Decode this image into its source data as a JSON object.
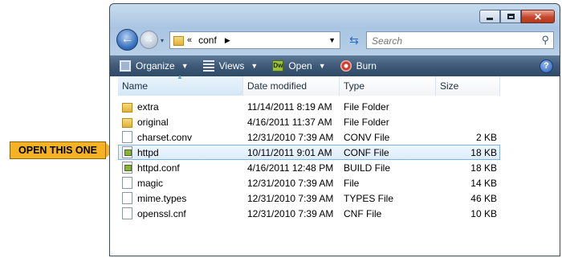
{
  "callout": {
    "text": "OPEN THIS ONE"
  },
  "nav": {
    "history_glyph": "▾",
    "breadcrumb_overflow": "«",
    "breadcrumb": "conf",
    "crumb_arrow": "▶",
    "address_dropdown": "▼",
    "refresh_icon": "refresh-icon"
  },
  "search": {
    "placeholder": "Search"
  },
  "toolbar": {
    "organize": "Organize",
    "views": "Views",
    "open": "Open",
    "burn": "Burn",
    "dropdown_glyph": "▼",
    "open_app_badge": "Dw"
  },
  "columns": {
    "name": "Name",
    "date": "Date modified",
    "type": "Type",
    "size": "Size"
  },
  "files": [
    {
      "name": "extra",
      "date": "11/14/2011 8:19 AM",
      "type": "File Folder",
      "size": "",
      "icon": "folder-icon"
    },
    {
      "name": "original",
      "date": "4/16/2011 11:37 AM",
      "type": "File Folder",
      "size": "",
      "icon": "folder-icon"
    },
    {
      "name": "charset.conv",
      "date": "12/31/2010 7:39 AM",
      "type": "CONV File",
      "size": "2 KB",
      "icon": "file-icon"
    },
    {
      "name": "httpd",
      "date": "10/11/2011 9:01 AM",
      "type": "CONF File",
      "size": "18 KB",
      "icon": "dreamweaver-file-icon",
      "selected": true
    },
    {
      "name": "httpd.conf",
      "date": "4/16/2011 12:48 PM",
      "type": "BUILD File",
      "size": "18 KB",
      "icon": "dreamweaver-file-icon"
    },
    {
      "name": "magic",
      "date": "12/31/2010 7:39 AM",
      "type": "File",
      "size": "14 KB",
      "icon": "file-icon"
    },
    {
      "name": "mime.types",
      "date": "12/31/2010 7:39 AM",
      "type": "TYPES File",
      "size": "46 KB",
      "icon": "file-icon"
    },
    {
      "name": "openssl.cnf",
      "date": "12/31/2010 7:39 AM",
      "type": "CNF File",
      "size": "10 KB",
      "icon": "file-icon"
    }
  ],
  "colors": {
    "callout": "#f5b324",
    "toolbar": "#3e5a78",
    "selection": "#dcecfb",
    "close_button": "#c6472b"
  }
}
